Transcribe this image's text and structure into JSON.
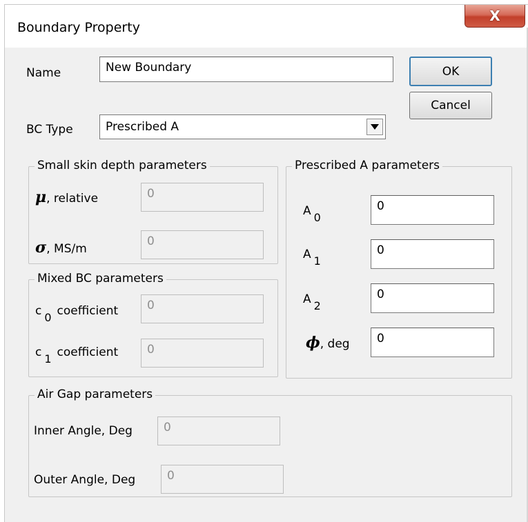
{
  "window": {
    "title": "Boundary Property",
    "close_label": "X"
  },
  "name": {
    "label": "Name",
    "value": "New Boundary"
  },
  "buttons": {
    "ok": "OK",
    "cancel": "Cancel"
  },
  "bc_type": {
    "label": "BC Type",
    "selected": "Prescribed A",
    "arrow_icon": "dropdown-arrow-icon"
  },
  "skin_depth": {
    "title": "Small skin depth parameters",
    "mu_symbol": "μ",
    "mu_label": ", relative",
    "mu_value": "0",
    "sigma_symbol": "σ",
    "sigma_label": ", MS/m",
    "sigma_value": "0"
  },
  "mixed": {
    "title": "Mixed BC parameters",
    "c0_letter": "c",
    "c0_sub": "0",
    "c0_label": "coefficient",
    "c0_value": "0",
    "c1_letter": "c",
    "c1_sub": "1",
    "c1_label": "coefficient",
    "c1_value": "0"
  },
  "prescribed": {
    "title": "Prescribed A parameters",
    "a0_letter": "A",
    "a0_sub": "0",
    "a0_value": "0",
    "a1_letter": "A",
    "a1_sub": "1",
    "a1_value": "0",
    "a2_letter": "A",
    "a2_sub": "2",
    "a2_value": "0",
    "phi_symbol": "ϕ",
    "phi_label": ", deg",
    "phi_value": "0"
  },
  "air_gap": {
    "title": "Air Gap parameters",
    "inner_label": "Inner Angle, Deg",
    "inner_value": "0",
    "outer_label": "Outer Angle, Deg",
    "outer_value": "0"
  }
}
